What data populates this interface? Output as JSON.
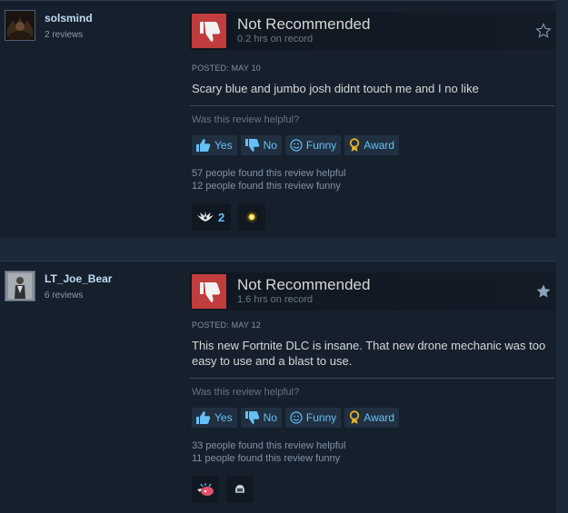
{
  "reviews": [
    {
      "username": "solsmind",
      "review_count": "2 reviews",
      "verdict": "Not Recommended",
      "hours": "0.2 hrs on record",
      "posted": "POSTED: MAY 10",
      "text": "Scary blue and jumbo josh didnt touch me and I no like",
      "helpful_question": "Was this review helpful?",
      "buttons": {
        "yes": "Yes",
        "no": "No",
        "funny": "Funny",
        "award": "Award"
      },
      "helpful_count": "57 people found this review helpful",
      "funny_count": "12 people found this review funny",
      "awards": [
        {
          "icon": "bird-award-icon",
          "count": "2"
        },
        {
          "icon": "glow-orb-award-icon"
        }
      ]
    },
    {
      "username": "LT_Joe_Bear",
      "review_count": "6 reviews",
      "verdict": "Not Recommended",
      "hours": "1.6 hrs on record",
      "posted": "POSTED: MAY 12",
      "text": "This new Fortnite DLC is insane. That new drone mechanic was too easy to use and a blast to use.",
      "helpful_question": "Was this review helpful?",
      "buttons": {
        "yes": "Yes",
        "no": "No",
        "funny": "Funny",
        "award": "Award"
      },
      "helpful_count": "33 people found this review helpful",
      "funny_count": "11 people found this review funny",
      "awards": [
        {
          "icon": "mind-blown-award-icon"
        },
        {
          "icon": "helmet-award-icon"
        }
      ]
    }
  ],
  "colors": {
    "background": "#1b2838",
    "card": "#16202d",
    "thumb_down": "#c13c3d",
    "link_blue": "#66c0f4",
    "award_gold": "#e3b02c"
  }
}
